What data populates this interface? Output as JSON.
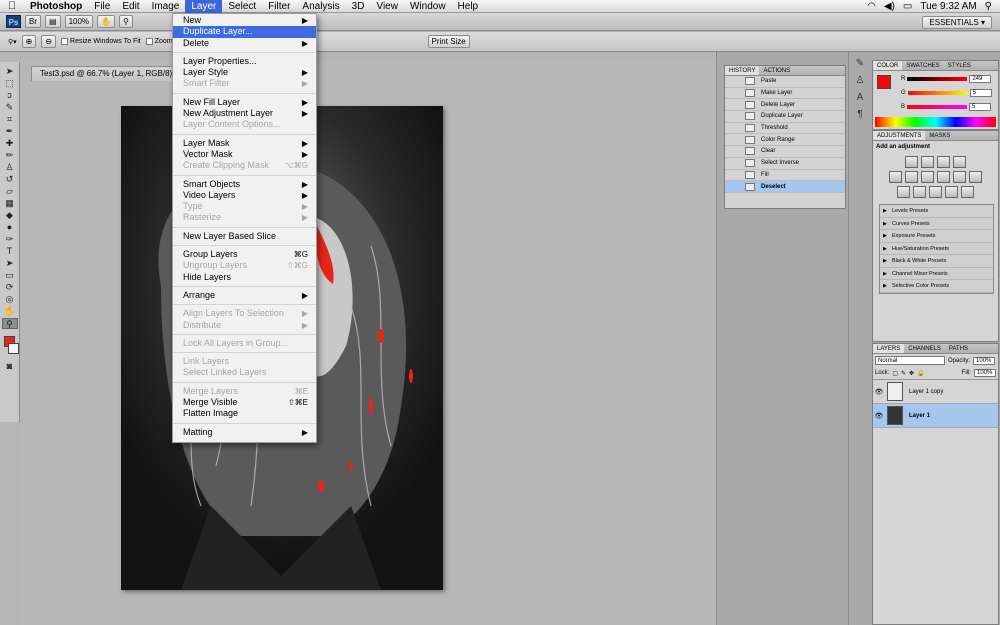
{
  "menubar": {
    "app_name": "Photoshop",
    "menus": [
      "File",
      "Edit",
      "Image",
      "Layer",
      "Select",
      "Filter",
      "Analysis",
      "3D",
      "View",
      "Window",
      "Help"
    ],
    "active_menu": "Layer",
    "clock": "Tue 9:32 AM"
  },
  "appbar": {
    "logo": "Ps",
    "zoom": "100%",
    "workspace": "ESSENTIALS ▾"
  },
  "options": {
    "resize_windows": "Resize Windows To Fit",
    "zoom_all": "Zoom All W",
    "print_size": "Print Size"
  },
  "document": {
    "tab_title": "Test3.psd @ 66.7% (Layer 1, RGB/8) *",
    "tab_title_suffix": "1, RGB/8) *"
  },
  "layer_menu": {
    "items": [
      {
        "label": "New",
        "sc": "▶"
      },
      {
        "label": "Duplicate Layer...",
        "sc": ""
      },
      {
        "label": "Delete",
        "sc": "▶"
      },
      {
        "label": "Layer Properties...",
        "sc": ""
      },
      {
        "label": "Layer Style",
        "sc": "▶"
      },
      {
        "label": "Smart Filter",
        "sc": "▶"
      },
      {
        "label": "New Fill Layer",
        "sc": "▶"
      },
      {
        "label": "New Adjustment Layer",
        "sc": "▶"
      },
      {
        "label": "Layer Content Options...",
        "sc": ""
      },
      {
        "label": "Layer Mask",
        "sc": "▶"
      },
      {
        "label": "Vector Mask",
        "sc": "▶"
      },
      {
        "label": "Create Clipping Mask",
        "sc": "⌥⌘G"
      },
      {
        "label": "Smart Objects",
        "sc": "▶"
      },
      {
        "label": "Video Layers",
        "sc": "▶"
      },
      {
        "label": "Type",
        "sc": "▶"
      },
      {
        "label": "Rasterize",
        "sc": "▶"
      },
      {
        "label": "New Layer Based Slice",
        "sc": ""
      },
      {
        "label": "Group Layers",
        "sc": "⌘G"
      },
      {
        "label": "Ungroup Layers",
        "sc": "⇧⌘G"
      },
      {
        "label": "Hide Layers",
        "sc": ""
      },
      {
        "label": "Arrange",
        "sc": "▶"
      },
      {
        "label": "Align Layers To Selection",
        "sc": "▶"
      },
      {
        "label": "Distribute",
        "sc": "▶"
      },
      {
        "label": "Lock All Layers in Group...",
        "sc": ""
      },
      {
        "label": "Link Layers",
        "sc": ""
      },
      {
        "label": "Select Linked Layers",
        "sc": ""
      },
      {
        "label": "Merge Layers",
        "sc": "⌘E"
      },
      {
        "label": "Merge Visible",
        "sc": "⇧⌘E"
      },
      {
        "label": "Flatten Image",
        "sc": ""
      },
      {
        "label": "Matting",
        "sc": "▶"
      }
    ]
  },
  "history": {
    "tabs": [
      "HISTORY",
      "ACTIONS"
    ],
    "rows": [
      "Paste",
      "Make Layer",
      "Delete Layer",
      "Duplicate Layer",
      "Threshold",
      "Color Range",
      "Clear",
      "Select Inverse",
      "Fill",
      "Deselect"
    ]
  },
  "color_panel": {
    "tabs": [
      "COLOR",
      "SWATCHES",
      "STYLES"
    ],
    "r_label": "R",
    "g_label": "G",
    "b_label": "B",
    "r": "249",
    "g": "5",
    "b": "5",
    "fg_color": "#f90505"
  },
  "adjustments": {
    "tabs": [
      "ADJUSTMENTS",
      "MASKS"
    ],
    "title": "Add an adjustment",
    "presets": [
      "Levels Presets",
      "Curves Presets",
      "Exposure Presets",
      "Hue/Saturation Presets",
      "Black & White Presets",
      "Channel Mixer Presets",
      "Selective Color Presets"
    ]
  },
  "layers_panel": {
    "tabs": [
      "LAYERS",
      "CHANNELS",
      "PATHS"
    ],
    "blend_mode": "Normal",
    "opacity_label": "Opacity:",
    "opacity": "100%",
    "lock_label": "Lock:",
    "fill_label": "Fill:",
    "fill": "100%",
    "layers": [
      "Layer 1 copy",
      "Layer 1"
    ]
  }
}
